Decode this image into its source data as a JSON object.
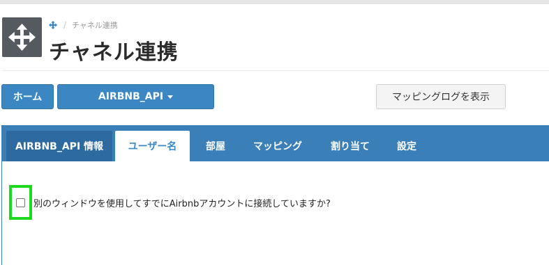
{
  "header": {
    "breadcrumb_current": "チャネル連携",
    "breadcrumb_separator": "/",
    "title": "チャネル連携"
  },
  "toolbar": {
    "home_label": "ホーム",
    "channel_label": "AIRBNB_API",
    "log_label": "マッピングログを表示"
  },
  "tabs": [
    {
      "label": "AIRBNB_API 情報"
    },
    {
      "label": "ユーザー名",
      "active": true
    },
    {
      "label": "部屋"
    },
    {
      "label": "マッピング"
    },
    {
      "label": "割り当て"
    },
    {
      "label": "設定"
    }
  ],
  "content": {
    "checkbox_label": "別のウィンドウを使用してすでにAirbnbアカウントに接続していますか?",
    "checkbox_checked": false
  },
  "colors": {
    "primary": "#3a87c3",
    "tabbar": "#3a7fb8",
    "highlight": "#1ed81e",
    "app_icon_bg": "#555a61"
  },
  "icons": {
    "app_icon": "move-arrows-icon",
    "breadcrumb_icon": "move-arrows-icon"
  }
}
